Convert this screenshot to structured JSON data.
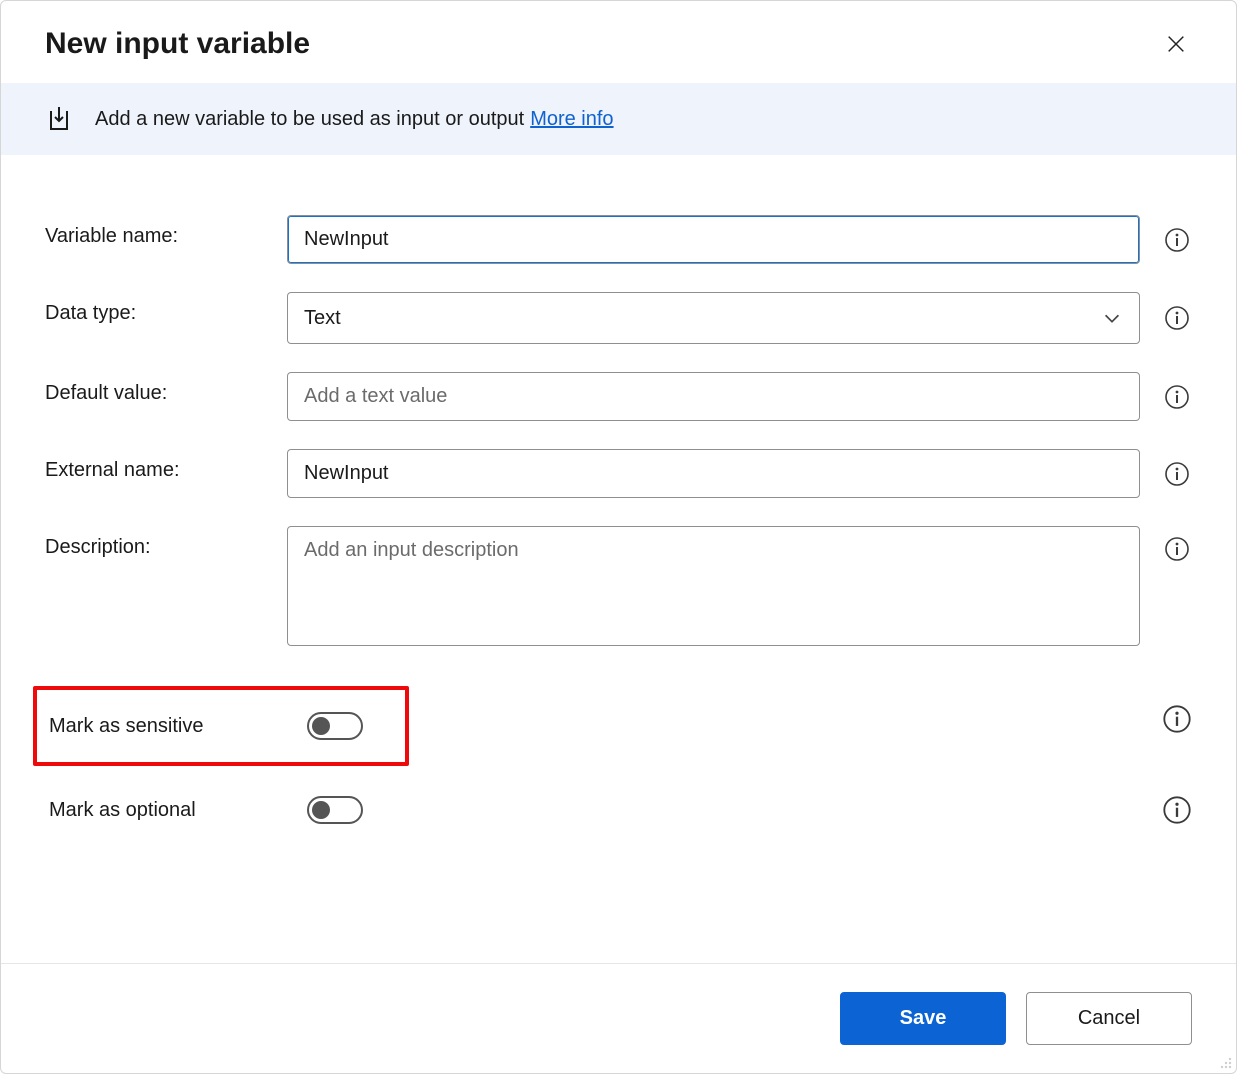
{
  "header": {
    "title": "New input variable"
  },
  "info_bar": {
    "text": "Add a new variable to be used as input or output",
    "link_label": "More info"
  },
  "form": {
    "variable_name": {
      "label": "Variable name:",
      "value": "NewInput"
    },
    "data_type": {
      "label": "Data type:",
      "value": "Text"
    },
    "default_value": {
      "label": "Default value:",
      "placeholder": "Add a text value",
      "value": ""
    },
    "external_name": {
      "label": "External name:",
      "value": "NewInput"
    },
    "description": {
      "label": "Description:",
      "placeholder": "Add an input description",
      "value": ""
    },
    "mark_sensitive": {
      "label": "Mark as sensitive",
      "value": false
    },
    "mark_optional": {
      "label": "Mark as optional",
      "value": false
    }
  },
  "footer": {
    "save_label": "Save",
    "cancel_label": "Cancel"
  }
}
